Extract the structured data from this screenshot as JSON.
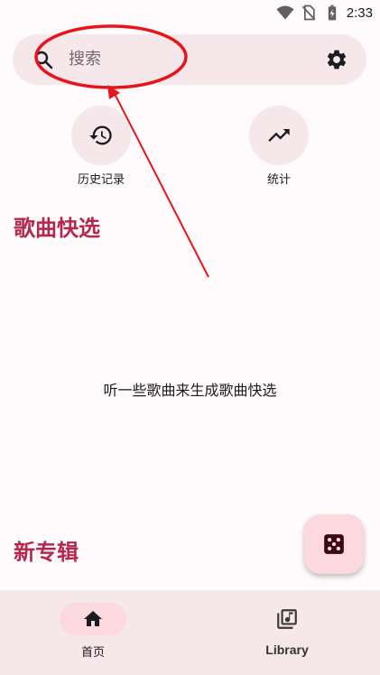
{
  "status_bar": {
    "time": "2:33",
    "icons": [
      "wifi-icon",
      "no-sim-icon",
      "battery-charging-icon"
    ]
  },
  "search": {
    "placeholder": "搜索",
    "left_icon": "search-icon",
    "right_icon": "settings-icon"
  },
  "quick_actions": [
    {
      "label": "历史记录",
      "icon": "history-icon"
    },
    {
      "label": "统计",
      "icon": "trending-up-icon"
    }
  ],
  "sections": {
    "quick_picks_title": "歌曲快选",
    "quick_picks_empty": "听一些歌曲来生成歌曲快选",
    "new_albums_title": "新专辑"
  },
  "fab": {
    "icon": "dice-icon"
  },
  "bottom_nav": [
    {
      "label": "首页",
      "icon": "home-icon",
      "active": true
    },
    {
      "label": "Library",
      "icon": "library-music-icon",
      "active": false
    }
  ],
  "colors": {
    "accent": "#b3284d",
    "surface": "#f6e7ea",
    "pill": "#fbd9df",
    "annotation": "#e8141c"
  }
}
